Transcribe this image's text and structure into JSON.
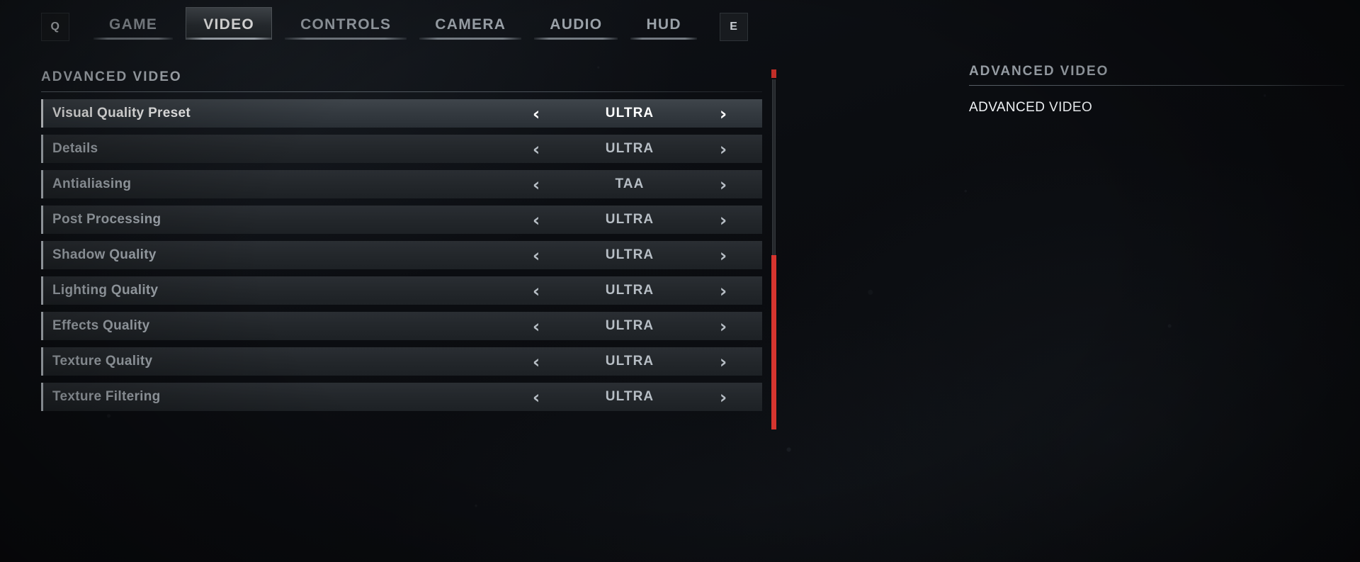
{
  "keys": {
    "left_label": "Q",
    "right_label": "E"
  },
  "tabs": [
    {
      "label": "GAME",
      "active": false
    },
    {
      "label": "VIDEO",
      "active": true
    },
    {
      "label": "CONTROLS",
      "active": false
    },
    {
      "label": "CAMERA",
      "active": false
    },
    {
      "label": "AUDIO",
      "active": false
    },
    {
      "label": "HUD",
      "active": false
    }
  ],
  "settings": {
    "section_title": "ADVANCED VIDEO",
    "left_arrow": "‹",
    "right_arrow": "›",
    "rows": [
      {
        "label": "Visual Quality Preset",
        "value": "ULTRA",
        "selected": true
      },
      {
        "label": "Details",
        "value": "ULTRA",
        "selected": false
      },
      {
        "label": "Antialiasing",
        "value": "TAA",
        "selected": false
      },
      {
        "label": "Post Processing",
        "value": "ULTRA",
        "selected": false
      },
      {
        "label": "Shadow Quality",
        "value": "ULTRA",
        "selected": false
      },
      {
        "label": "Lighting Quality",
        "value": "ULTRA",
        "selected": false
      },
      {
        "label": "Effects Quality",
        "value": "ULTRA",
        "selected": false
      },
      {
        "label": "Texture Quality",
        "value": "ULTRA",
        "selected": false
      },
      {
        "label": "Texture Filtering",
        "value": "ULTRA",
        "selected": false
      }
    ]
  },
  "info_panel": {
    "title": "ADVANCED VIDEO",
    "body": "ADVANCED VIDEO"
  },
  "scrollbar": {
    "thumb_color": "#d6352f",
    "marker_color": "#c22e28"
  },
  "colors": {
    "accent_red": "#d6352f",
    "row_bg": "#23272b",
    "row_bg_selected": "#343a40",
    "text_primary": "#ffffff",
    "text_secondary": "#a7aeb5",
    "background": "#0a0c0e"
  }
}
